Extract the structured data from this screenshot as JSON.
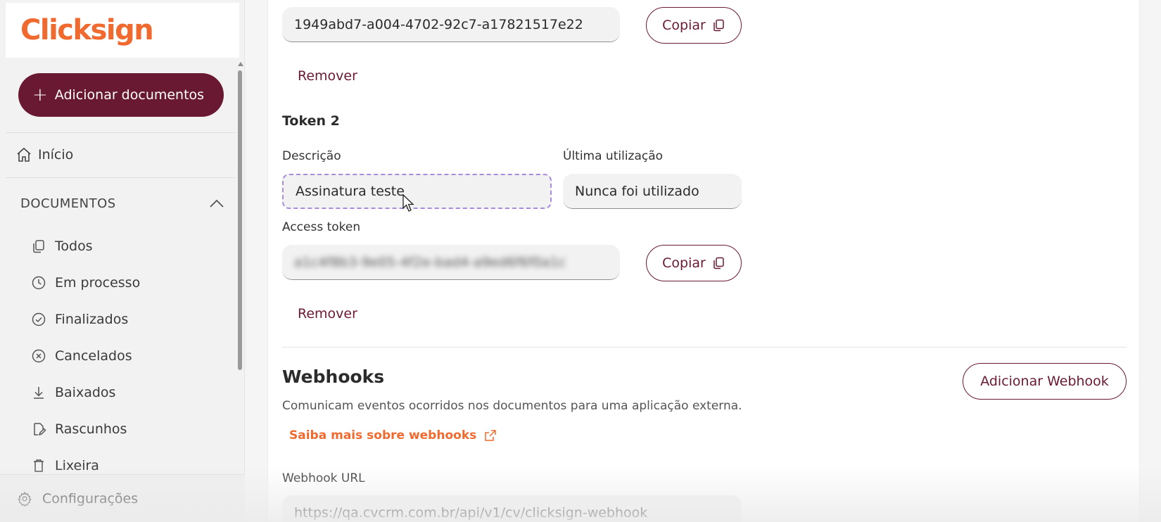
{
  "brand": {
    "name": "Clicksign",
    "accent": "#f06a30",
    "primary": "#6a1932"
  },
  "sidebar": {
    "add_button": "Adicionar documentos",
    "home": "Início",
    "section_title": "DOCUMENTOS",
    "items": [
      {
        "label": "Todos",
        "icon": "copy-icon"
      },
      {
        "label": "Em processo",
        "icon": "clock-icon"
      },
      {
        "label": "Finalizados",
        "icon": "check-circle-icon"
      },
      {
        "label": "Cancelados",
        "icon": "x-circle-icon"
      },
      {
        "label": "Baixados",
        "icon": "download-icon"
      },
      {
        "label": "Rascunhos",
        "icon": "draft-icon"
      },
      {
        "label": "Lixeira",
        "icon": "trash-icon"
      }
    ],
    "settings": "Configurações"
  },
  "token1": {
    "value": "1949abd7-a004-4702-92c7-a17821517e22",
    "copy_label": "Copiar",
    "remove_label": "Remover"
  },
  "token2": {
    "title": "Token 2",
    "description_label": "Descrição",
    "description_value": "Assinatura teste",
    "last_used_label": "Última utilização",
    "last_used_value": "Nunca foi utilizado",
    "access_token_label": "Access token",
    "access_token_value": "a1c4f8b3-9e05-4f2e-bad4-a9ed6f6f0a1c",
    "copy_label": "Copiar",
    "remove_label": "Remover"
  },
  "webhooks": {
    "title": "Webhooks",
    "description": "Comunicam eventos ocorridos nos documentos para uma aplicação externa.",
    "learn_more": "Saiba mais sobre webhooks",
    "add_button": "Adicionar Webhook",
    "url_label": "Webhook URL",
    "url_value": "https://qa.cvcrm.com.br/api/v1/cv/clicksign-webhook"
  }
}
